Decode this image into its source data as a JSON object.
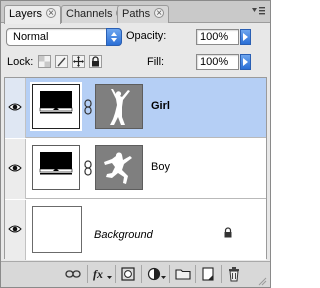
{
  "tabs": [
    {
      "label": "Layers",
      "active": true
    },
    {
      "label": "Channels",
      "active": false
    },
    {
      "label": "Paths",
      "active": false
    }
  ],
  "blend": {
    "value": "Normal"
  },
  "opacity": {
    "label": "Opacity:",
    "value": "100%"
  },
  "lock": {
    "label": "Lock:"
  },
  "fill": {
    "label": "Fill:",
    "value": "100%"
  },
  "layers": [
    {
      "name": "Girl",
      "selected": true,
      "visible": true,
      "has_mask": true,
      "style": "bold"
    },
    {
      "name": "Boy",
      "selected": false,
      "visible": true,
      "has_mask": true,
      "style": "normal"
    },
    {
      "name": "Background",
      "selected": false,
      "visible": true,
      "has_mask": false,
      "style": "italic",
      "locked": true
    }
  ],
  "bottom_icons": [
    "link-layers-icon",
    "fx-icon",
    "add-mask-icon",
    "adjustment-layer-icon",
    "new-group-icon",
    "new-layer-icon",
    "trash-icon"
  ],
  "colors": {
    "selection": "#b5cff5",
    "mask_gray": "#7f7f7f",
    "aqua_blue": "#2b6fd6"
  }
}
